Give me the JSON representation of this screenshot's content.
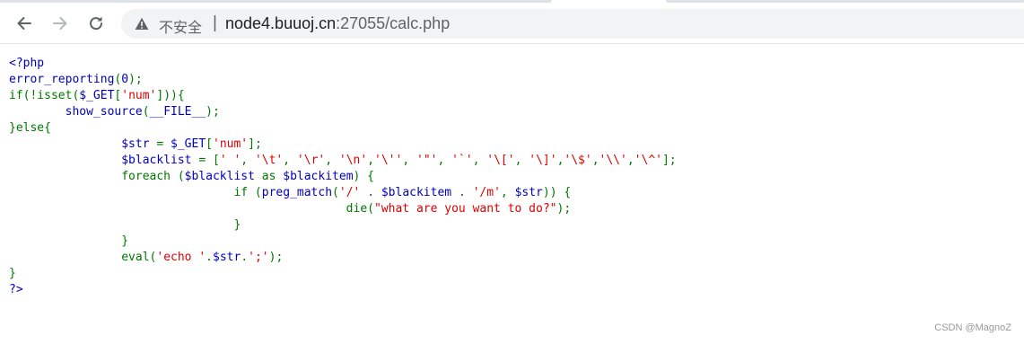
{
  "browser": {
    "security_label": "不安全",
    "separator": "|",
    "url_host": "node4.buuoj.cn",
    "url_rest": ":27055/calc.php",
    "icons": {
      "back": "back-arrow-icon",
      "forward": "forward-arrow-icon",
      "reload": "reload-icon",
      "security": "warning-triangle-icon"
    }
  },
  "source": {
    "lines": [
      [
        {
          "c": "b",
          "t": "<?php"
        }
      ],
      [
        {
          "c": "b",
          "t": "error_reporting"
        },
        {
          "c": "g",
          "t": "("
        },
        {
          "c": "b",
          "t": "0"
        },
        {
          "c": "g",
          "t": ");"
        }
      ],
      [
        {
          "c": "g",
          "t": "if(!isset("
        },
        {
          "c": "b",
          "t": "$_GET"
        },
        {
          "c": "g",
          "t": "["
        },
        {
          "c": "r",
          "t": "'num'"
        },
        {
          "c": "g",
          "t": "])){"
        }
      ],
      [
        {
          "c": "g",
          "t": "        "
        },
        {
          "c": "b",
          "t": "show_source"
        },
        {
          "c": "g",
          "t": "("
        },
        {
          "c": "b",
          "t": "__FILE__"
        },
        {
          "c": "g",
          "t": ");"
        }
      ],
      [
        {
          "c": "g",
          "t": "}else{"
        }
      ],
      [
        {
          "c": "g",
          "t": "                "
        },
        {
          "c": "b",
          "t": "$str "
        },
        {
          "c": "g",
          "t": "= "
        },
        {
          "c": "b",
          "t": "$_GET"
        },
        {
          "c": "g",
          "t": "["
        },
        {
          "c": "r",
          "t": "'num'"
        },
        {
          "c": "g",
          "t": "];"
        }
      ],
      [
        {
          "c": "g",
          "t": "                "
        },
        {
          "c": "b",
          "t": "$blacklist "
        },
        {
          "c": "g",
          "t": "= ["
        },
        {
          "c": "r",
          "t": "' '"
        },
        {
          "c": "g",
          "t": ", "
        },
        {
          "c": "r",
          "t": "'\\t'"
        },
        {
          "c": "g",
          "t": ", "
        },
        {
          "c": "r",
          "t": "'\\r'"
        },
        {
          "c": "g",
          "t": ", "
        },
        {
          "c": "r",
          "t": "'\\n'"
        },
        {
          "c": "g",
          "t": ","
        },
        {
          "c": "r",
          "t": "'\\''"
        },
        {
          "c": "g",
          "t": ", "
        },
        {
          "c": "r",
          "t": "'\"'"
        },
        {
          "c": "g",
          "t": ", "
        },
        {
          "c": "r",
          "t": "'`'"
        },
        {
          "c": "g",
          "t": ", "
        },
        {
          "c": "r",
          "t": "'\\['"
        },
        {
          "c": "g",
          "t": ", "
        },
        {
          "c": "r",
          "t": "'\\]'"
        },
        {
          "c": "g",
          "t": ","
        },
        {
          "c": "r",
          "t": "'\\$'"
        },
        {
          "c": "g",
          "t": ","
        },
        {
          "c": "r",
          "t": "'\\\\'"
        },
        {
          "c": "g",
          "t": ","
        },
        {
          "c": "r",
          "t": "'\\^'"
        },
        {
          "c": "g",
          "t": "];"
        }
      ],
      [
        {
          "c": "g",
          "t": "                foreach ("
        },
        {
          "c": "b",
          "t": "$blacklist "
        },
        {
          "c": "g",
          "t": "as "
        },
        {
          "c": "b",
          "t": "$blackitem"
        },
        {
          "c": "g",
          "t": ") {"
        }
      ],
      [
        {
          "c": "g",
          "t": "                                if ("
        },
        {
          "c": "b",
          "t": "preg_match"
        },
        {
          "c": "g",
          "t": "("
        },
        {
          "c": "r",
          "t": "'/' "
        },
        {
          "c": "g",
          "t": ". "
        },
        {
          "c": "b",
          "t": "$blackitem "
        },
        {
          "c": "g",
          "t": ". "
        },
        {
          "c": "r",
          "t": "'/m'"
        },
        {
          "c": "g",
          "t": ", "
        },
        {
          "c": "b",
          "t": "$str"
        },
        {
          "c": "g",
          "t": ")) {"
        }
      ],
      [
        {
          "c": "g",
          "t": "                                                die("
        },
        {
          "c": "r",
          "t": "\"what are you want to do?\""
        },
        {
          "c": "g",
          "t": ");"
        }
      ],
      [
        {
          "c": "g",
          "t": "                                }"
        }
      ],
      [
        {
          "c": "g",
          "t": "                }"
        }
      ],
      [
        {
          "c": "g",
          "t": "                eval("
        },
        {
          "c": "r",
          "t": "'echo '"
        },
        {
          "c": "g",
          "t": "."
        },
        {
          "c": "b",
          "t": "$str"
        },
        {
          "c": "g",
          "t": "."
        },
        {
          "c": "r",
          "t": "';'"
        },
        {
          "c": "g",
          "t": ");"
        }
      ],
      [
        {
          "c": "g",
          "t": "}"
        }
      ],
      [
        {
          "c": "b",
          "t": "?>"
        }
      ]
    ]
  },
  "watermark": "CSDN @MagnoZ"
}
